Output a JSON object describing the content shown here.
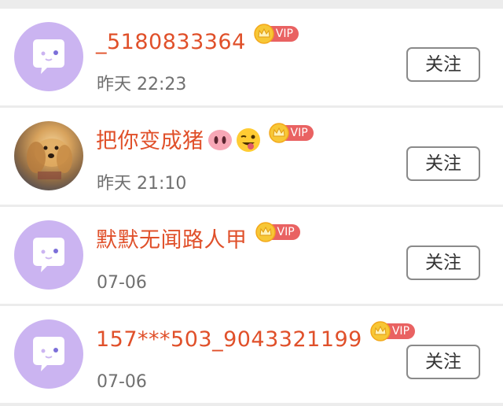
{
  "colors": {
    "name": "#e0502a",
    "vip_badge": "#e96262",
    "avatar_default": "#cbb4f1",
    "time": "#707070"
  },
  "vip_label": "VIP",
  "follow_label": "关注",
  "users": [
    {
      "name": "_5180833364",
      "time": "昨天 22:23",
      "avatar": "default-avatar-icon",
      "emojis": []
    },
    {
      "name": "把你变成猪",
      "time": "昨天 21:10",
      "avatar": "dog-photo-avatar",
      "emojis": [
        "pig-nose-emoji",
        "winking-tongue-emoji"
      ]
    },
    {
      "name": "默默无闻路人甲",
      "time": "07-06",
      "avatar": "default-avatar-icon",
      "emojis": []
    },
    {
      "name": "157***503_9043321199",
      "time": "07-06",
      "avatar": "default-avatar-icon",
      "emojis": []
    }
  ]
}
